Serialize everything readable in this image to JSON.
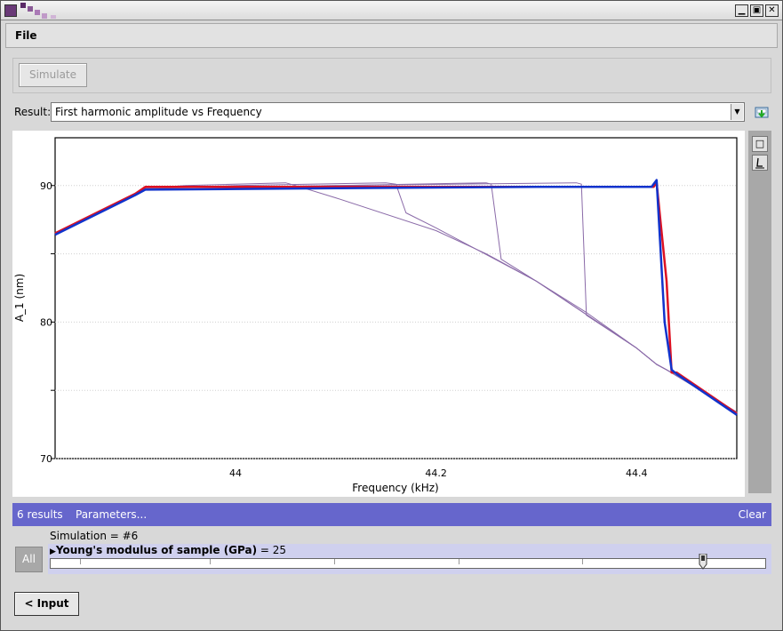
{
  "menu": {
    "file_label": "File"
  },
  "toolbar": {
    "simulate_label": "Simulate"
  },
  "result": {
    "label": "Result:",
    "selected": "First harmonic amplitude vs Frequency"
  },
  "chart_data": {
    "type": "line",
    "title": "",
    "xlabel": "Frequency (kHz)",
    "ylabel": "A_1 (nm)",
    "xlim": [
      43.82,
      44.5
    ],
    "ylim": [
      70,
      93.5
    ],
    "x_ticks": [
      44,
      44.2,
      44.4
    ],
    "y_ticks": [
      70,
      80,
      90
    ],
    "grid": true,
    "colors": {
      "thin": "#8a6aa8",
      "red": "#dd1122",
      "blue": "#1133cc"
    },
    "series": [
      {
        "color": "thin",
        "width": 1,
        "x": [
          43.82,
          43.9,
          43.91,
          43.95,
          44.05,
          44.06,
          44.1,
          44.2,
          44.25,
          44.3,
          44.35,
          44.4,
          44.42,
          44.43,
          44.5
        ],
        "y": [
          86.5,
          89.4,
          89.8,
          90.0,
          90.2,
          90.0,
          89.1,
          86.7,
          85.0,
          83.0,
          80.7,
          78.1,
          76.9,
          76.5,
          73.4
        ]
      },
      {
        "color": "thin",
        "width": 1,
        "x": [
          43.82,
          43.9,
          43.91,
          44.0,
          44.15,
          44.16,
          44.17,
          44.2,
          44.3,
          44.4,
          44.42,
          44.43,
          44.5
        ],
        "y": [
          86.5,
          89.4,
          89.8,
          90.0,
          90.2,
          90.1,
          88.0,
          86.9,
          83.0,
          78.1,
          76.9,
          76.5,
          73.4
        ]
      },
      {
        "color": "thin",
        "width": 1,
        "x": [
          43.82,
          43.9,
          43.91,
          44.1,
          44.25,
          44.255,
          44.265,
          44.3,
          44.4,
          44.42,
          44.43,
          44.5
        ],
        "y": [
          86.5,
          89.4,
          89.8,
          90.0,
          90.2,
          90.1,
          84.6,
          83.0,
          78.1,
          76.9,
          76.5,
          73.4
        ]
      },
      {
        "color": "thin",
        "width": 1,
        "x": [
          43.82,
          43.9,
          43.91,
          44.1,
          44.34,
          44.345,
          44.35,
          44.4,
          44.42,
          44.43,
          44.5
        ],
        "y": [
          86.5,
          89.4,
          89.8,
          90.0,
          90.2,
          90.1,
          80.5,
          78.1,
          76.9,
          76.5,
          73.4
        ]
      },
      {
        "color": "red",
        "width": 2.5,
        "x": [
          43.82,
          43.9,
          43.91,
          44.2,
          44.417,
          44.42,
          44.43,
          44.435,
          44.44,
          44.5
        ],
        "y": [
          86.5,
          89.4,
          89.9,
          89.9,
          89.9,
          90.2,
          83.0,
          76.3,
          76.3,
          73.3
        ]
      },
      {
        "color": "blue",
        "width": 2.5,
        "x": [
          43.82,
          43.9,
          43.91,
          44.1,
          44.3,
          44.415,
          44.42,
          44.428,
          44.435,
          44.44,
          44.5
        ],
        "y": [
          86.4,
          89.3,
          89.7,
          89.8,
          89.9,
          89.9,
          90.4,
          80.0,
          76.5,
          76.2,
          73.2
        ]
      }
    ]
  },
  "results_bar": {
    "count": "6 results",
    "parameters": "Parameters...",
    "clear": "Clear"
  },
  "simulation_label": "Simulation = #6",
  "all_label": "All",
  "parameter": {
    "name": "Young's modulus of sample (GPa)",
    "value_text": " = 25",
    "fraction": 0.913
  },
  "input_button_label": "< Input"
}
